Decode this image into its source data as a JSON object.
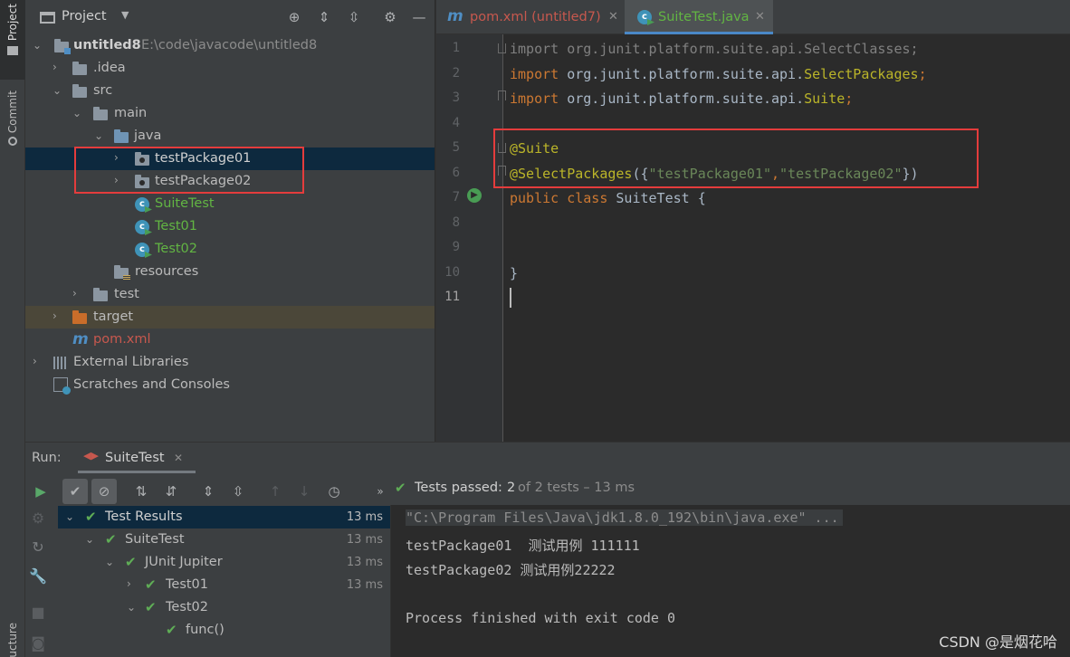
{
  "tool_strip": {
    "project_tab": "Project",
    "commit_tab": "Commit",
    "structure_tab": "ucture"
  },
  "project": {
    "title": "Project",
    "tree": {
      "root_name": "untitled8",
      "root_path": "E:\\code\\javacode\\untitled8",
      "idea": ".idea",
      "src": "src",
      "main": "main",
      "java": "java",
      "pkg1": "testPackage01",
      "pkg2": "testPackage02",
      "suite_test": "SuiteTest",
      "test01": "Test01",
      "test02": "Test02",
      "resources": "resources",
      "test": "test",
      "target": "target",
      "pom": "pom.xml",
      "ext_libs": "External Libraries",
      "scratches": "Scratches and Consoles"
    }
  },
  "editor": {
    "tabs": [
      {
        "label": "pom.xml (untitled7)",
        "icon": "maven-icon"
      },
      {
        "label": "SuiteTest.java",
        "icon": "java-class-icon",
        "active": true
      }
    ],
    "line_numbers": [
      "1",
      "2",
      "3",
      "4",
      "5",
      "6",
      "7",
      "8",
      "9",
      "10",
      "11"
    ],
    "code": {
      "l1_kw": "import",
      "l1_pkg": " org.junit.platform.suite.api.SelectClasses;",
      "l2_kw": "import",
      "l2_pkg": " org.junit.platform.suite.api.",
      "l2_cls": "SelectPackages",
      "l2_end": ";",
      "l3_kw": "import",
      "l3_pkg": " org.junit.platform.suite.api.",
      "l3_cls": "Suite",
      "l3_end": ";",
      "l5_ann": "@Suite",
      "l6_ann": "@SelectPackages",
      "l6_open": "({",
      "l6_s1": "\"testPackage01\"",
      "l6_comma": ",",
      "l6_s2": "\"testPackage02\"",
      "l6_close": "})",
      "l7_kw": "public class",
      "l7_rest": " SuiteTest {",
      "l10": "}"
    }
  },
  "run": {
    "label": "Run:",
    "tab": "SuiteTest",
    "status_prefix": "Tests passed:",
    "status_count": "2",
    "status_suffix": "of 2 tests – 13 ms",
    "tree": [
      {
        "label": "Test Results",
        "time": "13 ms"
      },
      {
        "label": "SuiteTest",
        "time": "13 ms"
      },
      {
        "label": "JUnit Jupiter",
        "time": "13 ms"
      },
      {
        "label": "Test01",
        "time": "13 ms"
      },
      {
        "label": "Test02",
        "time": ""
      },
      {
        "label": "func()",
        "time": ""
      }
    ],
    "console": [
      "\"C:\\Program Files\\Java\\jdk1.8.0_192\\bin\\java.exe\" ...",
      "testPackage01  测试用例 111111",
      "testPackage02 测试用例22222",
      "",
      "Process finished with exit code 0"
    ]
  },
  "watermark": "CSDN @是烟花哈",
  "colors": {
    "keyword": "#cc7832",
    "annotation": "#bbb529",
    "string": "#6a8759",
    "pass": "#5fad56",
    "highlight_box": "#e43c3c",
    "selection": "#0d293e"
  }
}
